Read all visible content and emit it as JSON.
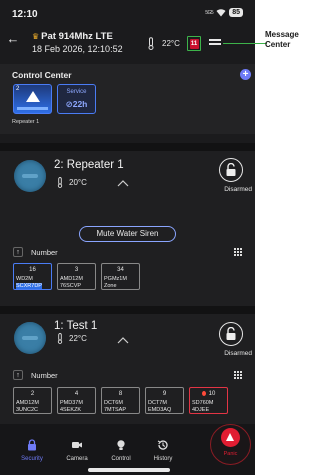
{
  "status_bar": {
    "time": "12:10",
    "signal": "5G5",
    "battery": "85"
  },
  "header": {
    "site_name": "Pat 914Mhz LTE",
    "date": "18 Feb 2026, 12:10:52",
    "temperature": "22°C",
    "message_badge": "11"
  },
  "control_center": {
    "title": "Control Center",
    "repeater_tile_number": "2",
    "repeater_label": "Repeater 1",
    "service_label": "Service",
    "service_value": "⊘22h"
  },
  "partitions": [
    {
      "name": "2: Repeater 1",
      "temperature": "20°C",
      "status": "Disarmed",
      "action_label": "Mute Water Siren",
      "sort_label": "Number",
      "zones": [
        {
          "num": "16",
          "line1": "WD2M",
          "line2": "SCXR7DP"
        },
        {
          "num": "3",
          "line1": "AMD12M",
          "line2": "76SCVP"
        },
        {
          "num": "34",
          "line1": "PGMz1M",
          "line2": "Zone"
        }
      ]
    },
    {
      "name": "1: Test 1",
      "temperature": "22°C",
      "status": "Disarmed",
      "sort_label": "Number",
      "zones": [
        {
          "num": "2",
          "line1": "AMD12M",
          "line2": "3UNC2C"
        },
        {
          "num": "4",
          "line1": "PMD37M",
          "line2": "4SEKZK"
        },
        {
          "num": "8",
          "line1": "DCT6M",
          "line2": "7MTSAP"
        },
        {
          "num": "9",
          "line1": "DCT7M",
          "line2": "EMD3AQ"
        },
        {
          "num": "10",
          "line1": "SD760M",
          "line2": "4DJEE"
        }
      ]
    }
  ],
  "bottom_nav": {
    "security": "Security",
    "camera": "Camera",
    "control": "Control",
    "history": "History",
    "panic": "Panic"
  },
  "callout": "Message Center",
  "colors": {
    "accent": "#6f7bf7",
    "tile_blue": "#4a7cf5",
    "panic_red": "#e11d32",
    "callout_green": "#3db34a",
    "background": "#1b1b1d"
  },
  "icons": [
    "back-arrow-icon",
    "crown-icon",
    "thermometer-icon",
    "message-center-icon",
    "menu-icon",
    "add-icon",
    "chevron-up-icon",
    "unlock-icon",
    "sort-up-icon",
    "grid-icon",
    "fire-icon",
    "lock-icon",
    "camera-icon",
    "bulb-icon",
    "history-icon",
    "panic-icon"
  ]
}
